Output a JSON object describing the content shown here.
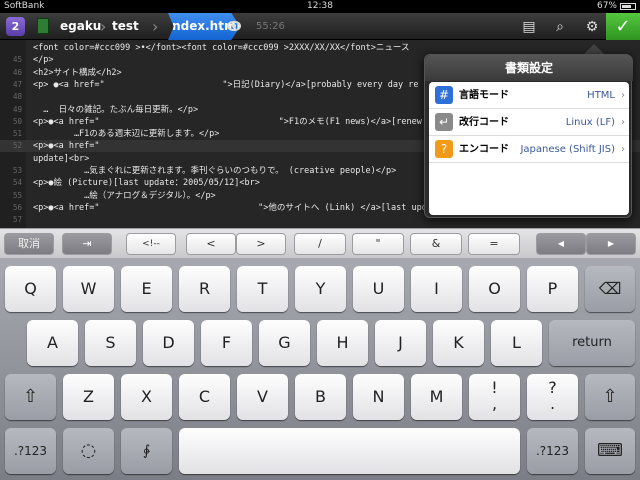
{
  "status": {
    "carrier": "SoftBank",
    "time": "12:38",
    "battery": "67%"
  },
  "toolbar": {
    "app_badge": "2",
    "crumbs": [
      "egaku",
      "test"
    ],
    "active_file": "index.html",
    "clock": "55:26",
    "done_check": "✓"
  },
  "editor": {
    "lines": [
      {
        "num": "",
        "code": "<font color=#ccc099 >•</font><font color=#ccc099 >2XXX/XX/XX</font>ニュース"
      },
      {
        "num": "45",
        "code": "</p>"
      },
      {
        "num": "46",
        "code": "<h2>サイト構成</h2>"
      },
      {
        "num": "47",
        "code": "<p> ●<a href=\"                       \">日記(Diary)</a>[probably every day re"
      },
      {
        "num": "48",
        "code": ""
      },
      {
        "num": "49",
        "code": "  …  日々の雑記。たぶん毎日更新。</p>"
      },
      {
        "num": "50",
        "code": "<p>●<a href=\"                                   \">F1のメモ(F1 news)</a>[renew i"
      },
      {
        "num": "51",
        "code": "        …F1のある週末辺に更新します。</p>"
      },
      {
        "num": "52",
        "code": "<p>●<a href=\""
      },
      {
        "num": "",
        "code": "update]<br>"
      },
      {
        "num": "53",
        "code": "          …気まぐれに更新されます。季刊ぐらいのつもりで。 (creative people)</p>"
      },
      {
        "num": "54",
        "code": "<p>●絵 (Picture)[last update：2005/05/12]<br>"
      },
      {
        "num": "55",
        "code": "          …絵（アナログ＆デジタル）。</p>"
      },
      {
        "num": "56",
        "code": "<p>●<a href=\"                               \">他のサイトへ (Link) </a>[last upd"
      },
      {
        "num": "57",
        "code": ""
      }
    ]
  },
  "popover": {
    "title": "書類設定",
    "rows": [
      {
        "label": "言語モード",
        "value": "HTML",
        "icon": "#"
      },
      {
        "label": "改行コード",
        "value": "Linux (LF)",
        "icon": "↵"
      },
      {
        "label": "エンコード",
        "value": "Japanese (Shift JIS)",
        "icon": "?"
      }
    ],
    "colors": {
      "hash": "#2f6fd8",
      "return": "#8a8a8a",
      "encode": "#f09a1a"
    }
  },
  "accessory": {
    "cancel": "取消",
    "tab": "⇥",
    "comment": "<!--",
    "lt": "<",
    "gt": ">",
    "slash": "/",
    "quote": "\"",
    "amp": "&",
    "eq": "=",
    "left": "◀",
    "right": "▶"
  },
  "keyboard": {
    "row1": [
      "Q",
      "W",
      "E",
      "R",
      "T",
      "Y",
      "U",
      "I",
      "O",
      "P"
    ],
    "row2": [
      "A",
      "S",
      "D",
      "F",
      "G",
      "H",
      "J",
      "K",
      "L"
    ],
    "row3": [
      "Z",
      "X",
      "C",
      "V",
      "B",
      "N",
      "M"
    ],
    "excl_top": "!",
    "excl_bottom": ",",
    "q_top": "?",
    "q_bottom": ".",
    "return": "return",
    "num": ".?123",
    "backspace": "⌫",
    "shift": "⇧",
    "globe": "◌",
    "mic": "∳",
    "hide": "⌨"
  }
}
